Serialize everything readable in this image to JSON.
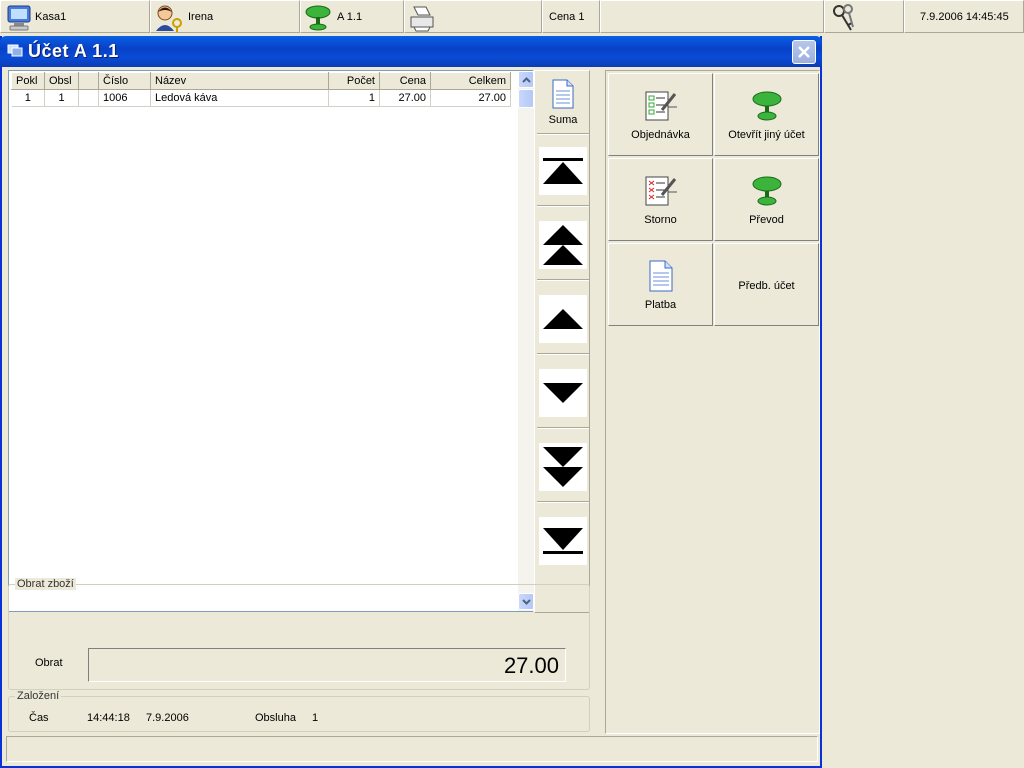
{
  "topbar": {
    "register": "Kasa1",
    "user": "Irena",
    "table": "A 1.1",
    "price_level": "Cena 1",
    "datetime": "7.9.2006  14:45:45"
  },
  "dialog": {
    "title": "Účet A 1.1"
  },
  "grid": {
    "columns": [
      "Pokl",
      "Obsl",
      "",
      "Číslo",
      "Název",
      "Počet",
      "Cena",
      "Celkem"
    ],
    "rows": [
      [
        "1",
        "1",
        "",
        "1006",
        "Ledová káva",
        "1",
        "27.00",
        "27.00"
      ]
    ]
  },
  "nav": {
    "suma_label": "Suma"
  },
  "actions": {
    "order": "Objednávka",
    "open_other": "Otevřít jiný účet",
    "storno": "Storno",
    "transfer": "Převod",
    "payment": "Platba",
    "prebill": "Předb. účet"
  },
  "turnover": {
    "legend": "Obrat zboží",
    "label": "Obrat",
    "value": "27.00"
  },
  "founded": {
    "legend": "Založení",
    "time_label": "Čas",
    "time": "14:44:18",
    "date": "7.9.2006",
    "staff_label": "Obsluha",
    "staff": "1"
  },
  "colors": {
    "titlebar": "#0a4bd5",
    "background": "#ece9d8",
    "accent_green": "#3cb43c"
  }
}
